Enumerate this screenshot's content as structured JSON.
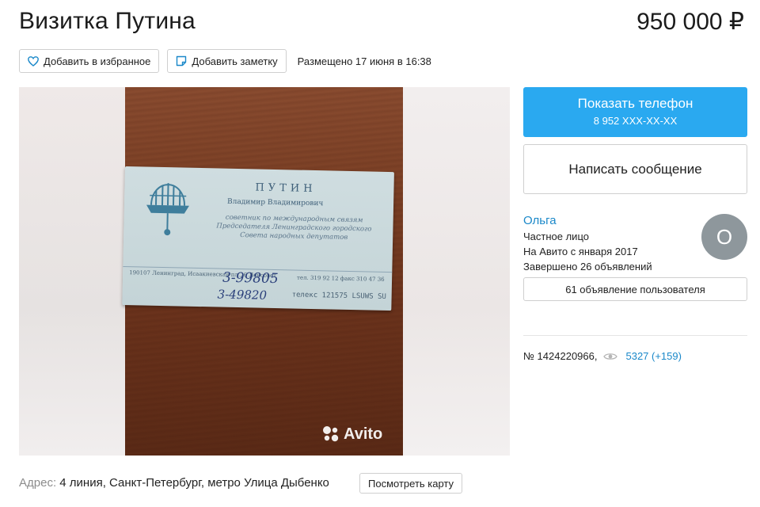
{
  "listing": {
    "title": "Визитка Путина",
    "price": "950 000 ₽"
  },
  "actions": {
    "favorite_label": "Добавить в избранное",
    "note_label": "Добавить заметку",
    "posted": "Размещено 17 июня в 16:38"
  },
  "gallery": {
    "watermark": "Avito",
    "card": {
      "surname": "ПУТИН",
      "patronymic": "Владимир Владимирович",
      "role": "советник по международным связям Председателя Ленинградского городского Совета народных депутатов",
      "address": "190107 Ленинград, Исаакиевская пл., 6 Ленсовет",
      "hand1": "3-99805",
      "hand2": "3-49820",
      "tel": "тел. 319 92 12 факс 310 47 36",
      "telex": "телекс 121575 LSUWS SU"
    }
  },
  "address": {
    "label": "Адрес:",
    "value": "4 линия, Санкт-Петербург, метро Улица Дыбенко",
    "map_button": "Посмотреть карту"
  },
  "sidebar": {
    "phone_label": "Показать телефон",
    "phone_number": "8 952 XXX-XX-XX",
    "message_label": "Написать сообщение",
    "seller": {
      "name": "Ольга",
      "type": "Частное лицо",
      "since": "На Авито с января 2017",
      "completed": "Завершено 26 объявлений",
      "avatar_letter": "О"
    },
    "ads_button": "61 объявление пользователя",
    "item_number": "№ 1424220966,",
    "views": "5327 (+159)"
  },
  "colors": {
    "accent": "#2aa9f0",
    "link": "#1a88c9",
    "avatar": "#8e979c"
  },
  "icons": {
    "favorite": "heart-icon",
    "note": "note-icon",
    "views": "eye-icon",
    "watermark": "avito-logo-icon"
  }
}
